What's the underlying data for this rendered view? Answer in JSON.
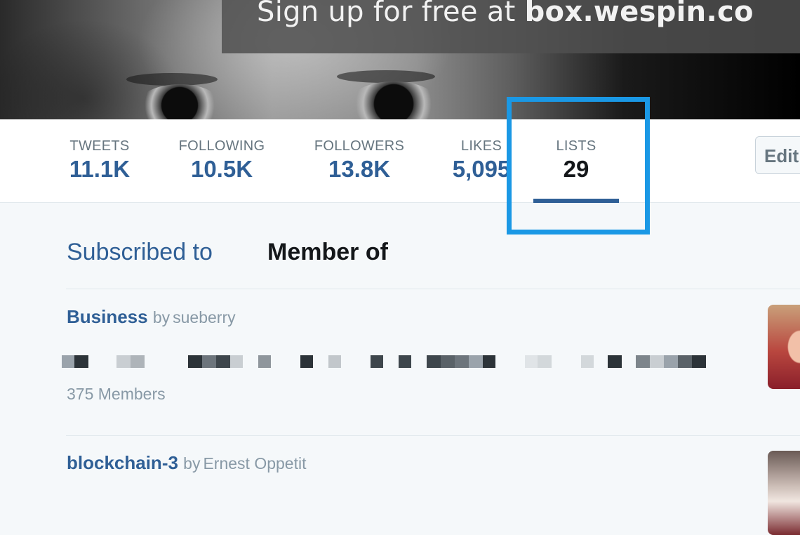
{
  "banner": {
    "tagline_prefix": "Sign up for free at ",
    "tagline_domain": "box.wespin.co"
  },
  "profile_nav": {
    "stats": [
      {
        "label": "TWEETS",
        "value": "11.1K"
      },
      {
        "label": "FOLLOWING",
        "value": "10.5K"
      },
      {
        "label": "FOLLOWERS",
        "value": "13.8K"
      },
      {
        "label": "LIKES",
        "value": "5,095"
      },
      {
        "label": "LISTS",
        "value": "29"
      }
    ],
    "active_stat": "LISTS",
    "edit_button": "Edit profile",
    "edit_button_visible": "Edit"
  },
  "lists_tabs": {
    "subscribed": "Subscribed to",
    "member_of": "Member of",
    "active": "Member of"
  },
  "lists": [
    {
      "name": "Business",
      "by_word": "by",
      "owner": "sueberry",
      "members": "375 Members"
    },
    {
      "name": "blockchain-3",
      "by_word": "by",
      "owner": "Ernest Oppetit",
      "members": ""
    }
  ],
  "colors": {
    "link_blue": "#2f5f96",
    "highlight": "#1a98e5",
    "muted": "#8899a6",
    "background": "#f5f8fa"
  }
}
